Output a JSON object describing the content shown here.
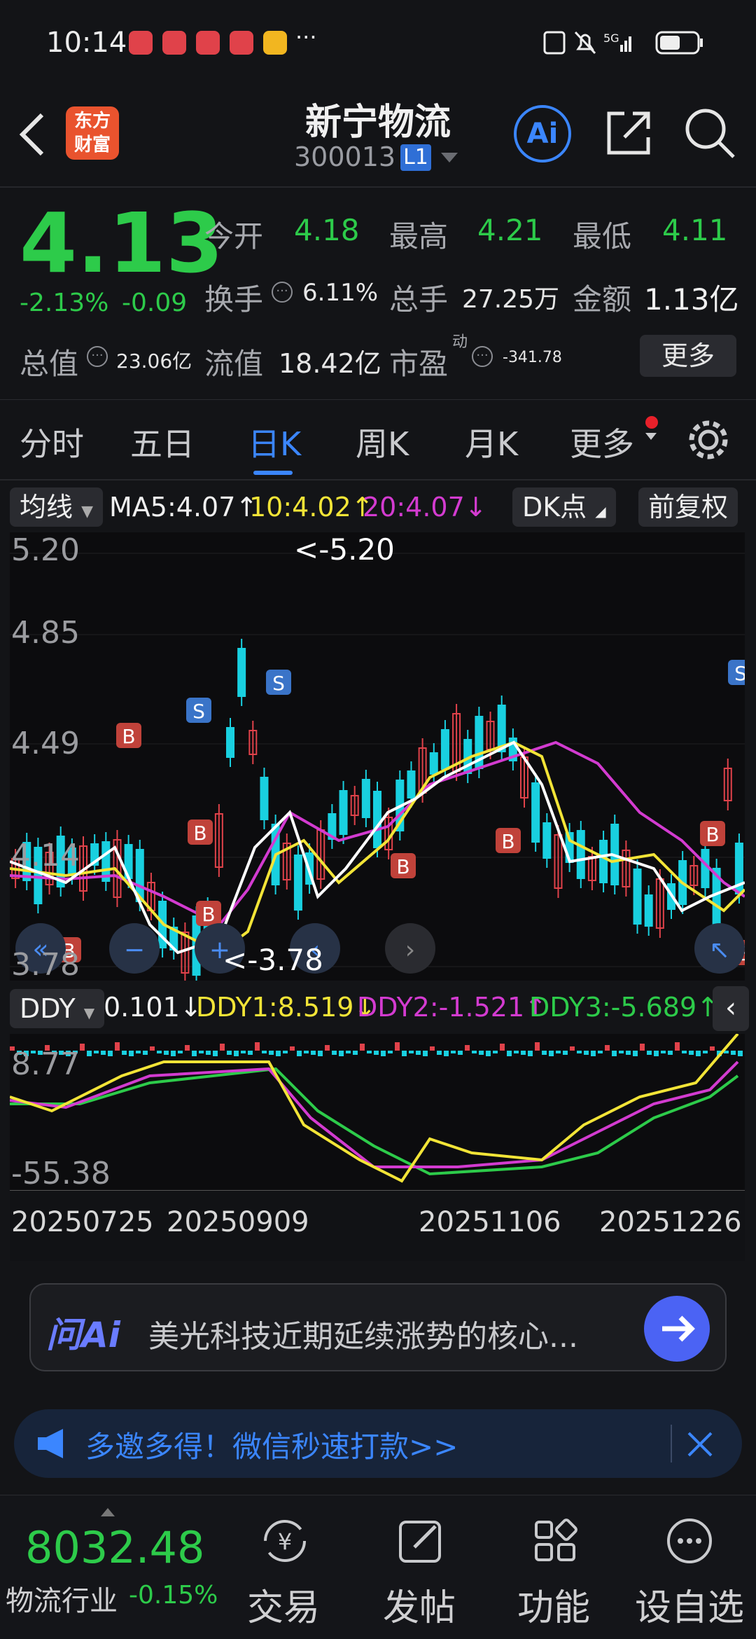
{
  "status_bar": {
    "time": "10:14",
    "dots": "···"
  },
  "header": {
    "stock_name": "新宁物流",
    "stock_code": "300013",
    "level": "L1",
    "logo_text": "东方财富",
    "ai_label": "Ai"
  },
  "quote": {
    "price": "4.13",
    "change_pct": "-2.13%",
    "change_amt": "-0.09",
    "open_label": "今开",
    "open": "4.18",
    "high_label": "最高",
    "high": "4.21",
    "low_label": "最低",
    "low": "4.11",
    "turnover_label": "换手",
    "turnover": "6.11%",
    "volume_label": "总手",
    "volume": "27.25万",
    "amount_label": "金额",
    "amount": "1.13亿",
    "mcap_label": "总值",
    "mcap": "23.06亿",
    "float_label": "流值",
    "float_cap": "18.42亿",
    "pe_label": "市盈",
    "pe_sup": "动",
    "pe": "-341.78",
    "more": "更多"
  },
  "tabs": [
    "分时",
    "五日",
    "日K",
    "周K",
    "月K",
    "更多"
  ],
  "active_tab": "日K",
  "ma_bar": {
    "selector": "均线",
    "ma5": "MA5:4.07↑",
    "ma10": "10:4.02↑",
    "ma20": "20:4.07↓",
    "dk": "DK点",
    "fuquan": "前复权"
  },
  "chart_labels": {
    "y1": "5.20",
    "y2": "4.85",
    "y3": "4.49",
    "y4": "4.14",
    "y5": "3.78",
    "max_note": "<-5.20",
    "min_note": "<-3.78"
  },
  "ddy_bar": {
    "selector": "DDY",
    "ddy": "0.101↓",
    "ddy1": "DDY1:8.519↓",
    "ddy2": "DDY2:-1.521↑",
    "ddy3": "DDY3:-5.689↑"
  },
  "ddy_labels": {
    "top": "8.77",
    "bottom": "-55.38"
  },
  "dates": [
    "20250725",
    "20250909",
    "20251106",
    "20251226"
  ],
  "ask_ai": {
    "logo": "问Ai",
    "text": "美光科技近期延续涨势的核心..."
  },
  "banner": {
    "text": "多邀多得！微信秒速打款>>"
  },
  "bottom_nav": {
    "index_value": "8032.48",
    "index_name": "物流行业",
    "index_change": "-0.15%",
    "items": [
      "交易",
      "发帖",
      "功能",
      "设自选"
    ]
  },
  "colors": {
    "up": "#e0424a",
    "down": "#2dcb4a",
    "accent": "#3b86ff",
    "ma5": "#ffffff",
    "ma10": "#f2e437",
    "ma20": "#d33bd0"
  }
}
